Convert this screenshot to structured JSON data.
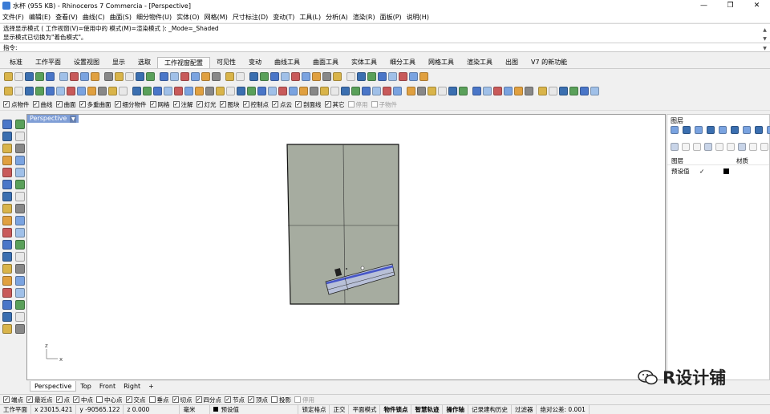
{
  "titlebar": {
    "title": "水杯 (955 KB) - Rhinoceros 7 Commercia - [Perspective]",
    "min": "—",
    "max": "❐",
    "close": "✕"
  },
  "menus": [
    "文件(F)",
    "编辑(E)",
    "查看(V)",
    "曲线(C)",
    "曲面(S)",
    "细分物件(U)",
    "实体(O)",
    "网格(M)",
    "尺寸标注(D)",
    "变动(T)",
    "工具(L)",
    "分析(A)",
    "渲染(R)",
    "面板(P)",
    "说明(H)"
  ],
  "command": {
    "history": [
      "选择显示模式 ( 工作视窗(V)=使用中的  模式(M)=渲染模式 ): _Mode=_Shaded",
      "显示模式已切换为\"着色模式\"。"
    ],
    "prompt": "指令:"
  },
  "tabs": [
    {
      "label": "标准",
      "active": false
    },
    {
      "label": "工作平面",
      "active": false
    },
    {
      "label": "设置视图",
      "active": false
    },
    {
      "label": "显示",
      "active": false
    },
    {
      "label": "选取",
      "active": false
    },
    {
      "label": "工作视窗配置",
      "active": true
    },
    {
      "label": "可见性",
      "active": false
    },
    {
      "label": "变动",
      "active": false
    },
    {
      "label": "曲线工具",
      "active": false
    },
    {
      "label": "曲面工具",
      "active": false
    },
    {
      "label": "实体工具",
      "active": false
    },
    {
      "label": "细分工具",
      "active": false
    },
    {
      "label": "网格工具",
      "active": false
    },
    {
      "label": "渲染工具",
      "active": false
    },
    {
      "label": "出图",
      "active": false
    },
    {
      "label": "V7 的新功能",
      "active": false
    }
  ],
  "filters": [
    {
      "label": "点物件",
      "on": true
    },
    {
      "label": "曲线",
      "on": true
    },
    {
      "label": "曲面",
      "on": true
    },
    {
      "label": "多重曲面",
      "on": true
    },
    {
      "label": "细分物件",
      "on": true
    },
    {
      "label": "网格",
      "on": true
    },
    {
      "label": "注解",
      "on": true
    },
    {
      "label": "灯光",
      "on": true
    },
    {
      "label": "图块",
      "on": true
    },
    {
      "label": "控制点",
      "on": true
    },
    {
      "label": "点云",
      "on": true
    },
    {
      "label": "剖面线",
      "on": true
    },
    {
      "label": "其它",
      "on": true
    },
    {
      "label": "停用",
      "on": false,
      "disabled": true
    },
    {
      "label": "子物件",
      "on": false,
      "disabled": true
    }
  ],
  "viewport": {
    "label": "Perspective",
    "axis_z": "z",
    "axis_x": "x"
  },
  "viewtabs": [
    {
      "label": "Perspective",
      "active": true
    },
    {
      "label": "Top",
      "active": false
    },
    {
      "label": "Front",
      "active": false
    },
    {
      "label": "Right",
      "active": false
    },
    {
      "label": "+",
      "active": false
    }
  ],
  "layers": {
    "panel_title": "图层",
    "col_layer": "图层",
    "col_material": "材质",
    "rows": [
      {
        "name": "预设值",
        "current": "✓",
        "color": "#000000"
      }
    ]
  },
  "osnaps": [
    {
      "label": "端点",
      "on": true
    },
    {
      "label": "最近点",
      "on": true
    },
    {
      "label": "点",
      "on": true
    },
    {
      "label": "中点",
      "on": true
    },
    {
      "label": "中心点",
      "on": false
    },
    {
      "label": "交点",
      "on": true
    },
    {
      "label": "垂点",
      "on": false
    },
    {
      "label": "切点",
      "on": true
    },
    {
      "label": "四分点",
      "on": true
    },
    {
      "label": "节点",
      "on": true
    },
    {
      "label": "顶点",
      "on": true
    },
    {
      "label": "投影",
      "on": false
    },
    {
      "label": "停用",
      "on": false,
      "disabled": true
    }
  ],
  "status": {
    "cplane": "工作平面",
    "x": "x 23015.421",
    "y": "y -90565.122",
    "z": "z 0.000",
    "unit": "毫米",
    "layer": "预设值",
    "items": [
      {
        "label": "锁定格点",
        "bold": false
      },
      {
        "label": "正交",
        "bold": false
      },
      {
        "label": "平面模式",
        "bold": false
      },
      {
        "label": "物件锁点",
        "bold": true
      },
      {
        "label": "智慧轨迹",
        "bold": true
      },
      {
        "label": "操作轴",
        "bold": true
      },
      {
        "label": "记录建构历史",
        "bold": false
      },
      {
        "label": "过滤器",
        "bold": false
      },
      {
        "label": "绝对公差: 0.001",
        "bold": false
      }
    ]
  },
  "watermark": {
    "text": "R设计铺"
  },
  "colors": {
    "viewport_label": "#7f9ed6",
    "object_fill": "#a6aca0",
    "accent": "#3a7bd5"
  }
}
